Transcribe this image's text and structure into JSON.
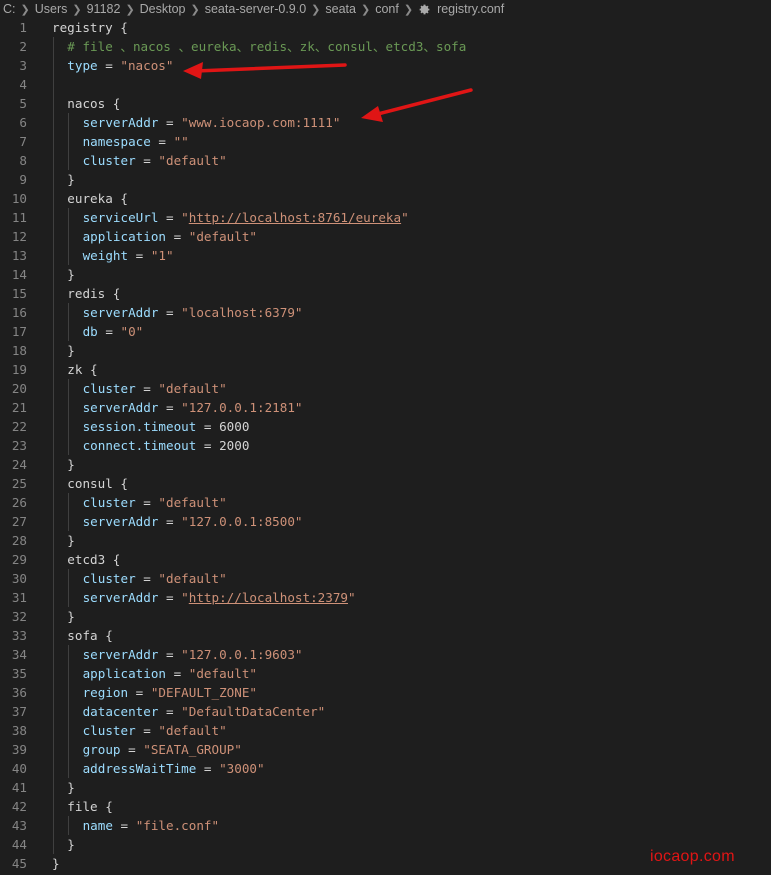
{
  "breadcrumb": {
    "items": [
      "C:",
      "Users",
      "91182",
      "Desktop",
      "seata-server-0.9.0",
      "seata",
      "conf"
    ],
    "file_icon": "gear-icon",
    "file": "registry.conf"
  },
  "editor": {
    "lines": [
      {
        "n": "1",
        "i": 0,
        "t": [
          [
            "p",
            "registry {"
          ]
        ]
      },
      {
        "n": "2",
        "i": 1,
        "t": [
          [
            "c",
            "# file 、nacos 、eureka、redis、zk、consul、etcd3、sofa"
          ]
        ]
      },
      {
        "n": "3",
        "i": 1,
        "t": [
          [
            "k",
            "type"
          ],
          [
            "p",
            " = "
          ],
          [
            "s",
            "\"nacos\""
          ]
        ]
      },
      {
        "n": "4",
        "i": 1,
        "t": []
      },
      {
        "n": "5",
        "i": 1,
        "t": [
          [
            "p",
            "nacos {"
          ]
        ]
      },
      {
        "n": "6",
        "i": 2,
        "t": [
          [
            "k",
            "serverAddr"
          ],
          [
            "p",
            " = "
          ],
          [
            "s",
            "\"www.iocaop.com:1111\""
          ]
        ]
      },
      {
        "n": "7",
        "i": 2,
        "t": [
          [
            "k",
            "namespace"
          ],
          [
            "p",
            " = "
          ],
          [
            "s",
            "\"\""
          ]
        ]
      },
      {
        "n": "8",
        "i": 2,
        "t": [
          [
            "k",
            "cluster"
          ],
          [
            "p",
            " = "
          ],
          [
            "s",
            "\"default\""
          ]
        ]
      },
      {
        "n": "9",
        "i": 1,
        "t": [
          [
            "p",
            "}"
          ]
        ]
      },
      {
        "n": "10",
        "i": 1,
        "t": [
          [
            "p",
            "eureka {"
          ]
        ]
      },
      {
        "n": "11",
        "i": 2,
        "t": [
          [
            "k",
            "serviceUrl"
          ],
          [
            "p",
            " = "
          ],
          [
            "s",
            "\""
          ],
          [
            "u",
            "http://localhost:8761/eureka"
          ],
          [
            "s",
            "\""
          ]
        ]
      },
      {
        "n": "12",
        "i": 2,
        "t": [
          [
            "k",
            "application"
          ],
          [
            "p",
            " = "
          ],
          [
            "s",
            "\"default\""
          ]
        ]
      },
      {
        "n": "13",
        "i": 2,
        "t": [
          [
            "k",
            "weight"
          ],
          [
            "p",
            " = "
          ],
          [
            "s",
            "\"1\""
          ]
        ]
      },
      {
        "n": "14",
        "i": 1,
        "t": [
          [
            "p",
            "}"
          ]
        ]
      },
      {
        "n": "15",
        "i": 1,
        "t": [
          [
            "p",
            "redis {"
          ]
        ]
      },
      {
        "n": "16",
        "i": 2,
        "t": [
          [
            "k",
            "serverAddr"
          ],
          [
            "p",
            " = "
          ],
          [
            "s",
            "\"localhost:6379\""
          ]
        ]
      },
      {
        "n": "17",
        "i": 2,
        "t": [
          [
            "k",
            "db"
          ],
          [
            "p",
            " = "
          ],
          [
            "s",
            "\"0\""
          ]
        ]
      },
      {
        "n": "18",
        "i": 1,
        "t": [
          [
            "p",
            "}"
          ]
        ]
      },
      {
        "n": "19",
        "i": 1,
        "t": [
          [
            "p",
            "zk {"
          ]
        ]
      },
      {
        "n": "20",
        "i": 2,
        "t": [
          [
            "k",
            "cluster"
          ],
          [
            "p",
            " = "
          ],
          [
            "s",
            "\"default\""
          ]
        ]
      },
      {
        "n": "21",
        "i": 2,
        "t": [
          [
            "k",
            "serverAddr"
          ],
          [
            "p",
            " = "
          ],
          [
            "s",
            "\"127.0.0.1:2181\""
          ]
        ]
      },
      {
        "n": "22",
        "i": 2,
        "t": [
          [
            "k",
            "session.timeout"
          ],
          [
            "p",
            " = "
          ],
          [
            "p",
            "6000"
          ]
        ]
      },
      {
        "n": "23",
        "i": 2,
        "t": [
          [
            "k",
            "connect.timeout"
          ],
          [
            "p",
            " = "
          ],
          [
            "p",
            "2000"
          ]
        ]
      },
      {
        "n": "24",
        "i": 1,
        "t": [
          [
            "p",
            "}"
          ]
        ]
      },
      {
        "n": "25",
        "i": 1,
        "t": [
          [
            "p",
            "consul {"
          ]
        ]
      },
      {
        "n": "26",
        "i": 2,
        "t": [
          [
            "k",
            "cluster"
          ],
          [
            "p",
            " = "
          ],
          [
            "s",
            "\"default\""
          ]
        ]
      },
      {
        "n": "27",
        "i": 2,
        "t": [
          [
            "k",
            "serverAddr"
          ],
          [
            "p",
            " = "
          ],
          [
            "s",
            "\"127.0.0.1:8500\""
          ]
        ]
      },
      {
        "n": "28",
        "i": 1,
        "t": [
          [
            "p",
            "}"
          ]
        ]
      },
      {
        "n": "29",
        "i": 1,
        "t": [
          [
            "p",
            "etcd3 {"
          ]
        ]
      },
      {
        "n": "30",
        "i": 2,
        "t": [
          [
            "k",
            "cluster"
          ],
          [
            "p",
            " = "
          ],
          [
            "s",
            "\"default\""
          ]
        ]
      },
      {
        "n": "31",
        "i": 2,
        "t": [
          [
            "k",
            "serverAddr"
          ],
          [
            "p",
            " = "
          ],
          [
            "s",
            "\""
          ],
          [
            "u",
            "http://localhost:2379"
          ],
          [
            "s",
            "\""
          ]
        ]
      },
      {
        "n": "32",
        "i": 1,
        "t": [
          [
            "p",
            "}"
          ]
        ]
      },
      {
        "n": "33",
        "i": 1,
        "t": [
          [
            "p",
            "sofa {"
          ]
        ]
      },
      {
        "n": "34",
        "i": 2,
        "t": [
          [
            "k",
            "serverAddr"
          ],
          [
            "p",
            " = "
          ],
          [
            "s",
            "\"127.0.0.1:9603\""
          ]
        ]
      },
      {
        "n": "35",
        "i": 2,
        "t": [
          [
            "k",
            "application"
          ],
          [
            "p",
            " = "
          ],
          [
            "s",
            "\"default\""
          ]
        ]
      },
      {
        "n": "36",
        "i": 2,
        "t": [
          [
            "k",
            "region"
          ],
          [
            "p",
            " = "
          ],
          [
            "s",
            "\"DEFAULT_ZONE\""
          ]
        ]
      },
      {
        "n": "37",
        "i": 2,
        "t": [
          [
            "k",
            "datacenter"
          ],
          [
            "p",
            " = "
          ],
          [
            "s",
            "\"DefaultDataCenter\""
          ]
        ]
      },
      {
        "n": "38",
        "i": 2,
        "t": [
          [
            "k",
            "cluster"
          ],
          [
            "p",
            " = "
          ],
          [
            "s",
            "\"default\""
          ]
        ]
      },
      {
        "n": "39",
        "i": 2,
        "t": [
          [
            "k",
            "group"
          ],
          [
            "p",
            " = "
          ],
          [
            "s",
            "\"SEATA_GROUP\""
          ]
        ]
      },
      {
        "n": "40",
        "i": 2,
        "t": [
          [
            "k",
            "addressWaitTime"
          ],
          [
            "p",
            " = "
          ],
          [
            "s",
            "\"3000\""
          ]
        ]
      },
      {
        "n": "41",
        "i": 1,
        "t": [
          [
            "p",
            "}"
          ]
        ]
      },
      {
        "n": "42",
        "i": 1,
        "t": [
          [
            "p",
            "file {"
          ]
        ]
      },
      {
        "n": "43",
        "i": 2,
        "t": [
          [
            "k",
            "name"
          ],
          [
            "p",
            " = "
          ],
          [
            "s",
            "\"file.conf\""
          ]
        ]
      },
      {
        "n": "44",
        "i": 1,
        "t": [
          [
            "p",
            "}"
          ]
        ]
      },
      {
        "n": "45",
        "i": 0,
        "t": [
          [
            "p",
            "}"
          ]
        ]
      }
    ]
  },
  "colors": {
    "background": "#1e1e1e",
    "key": "#9cdcfe",
    "string": "#ce9178",
    "comment": "#6a9955",
    "arrow": "#e01515"
  },
  "watermark": "iocaop.com"
}
